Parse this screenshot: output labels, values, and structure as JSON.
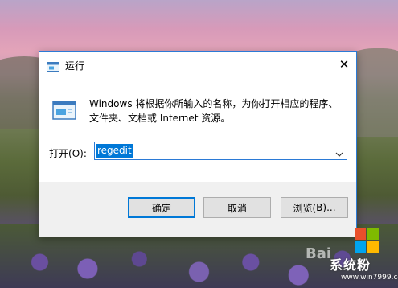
{
  "dialog": {
    "title": "运行",
    "close_glyph": "✕",
    "description": "Windows 将根据你所输入的名称，为你打开相应的程序、文件夹、文档或 Internet 资源。",
    "open_label_text": "打开(",
    "open_label_key": "O",
    "open_label_end": "):",
    "input_value": "regedit",
    "buttons": {
      "ok": "确定",
      "cancel": "取消",
      "browse_text": "浏览(",
      "browse_key": "B",
      "browse_end": ")..."
    },
    "accent_color": "#0078d7",
    "title_icon": "run-icon",
    "body_icon": "run-icon"
  },
  "watermark": {
    "brand": "系统粉",
    "url": "www.win7999.com",
    "logo_icon": "windows-logo-icon",
    "baidu": "Bai"
  }
}
